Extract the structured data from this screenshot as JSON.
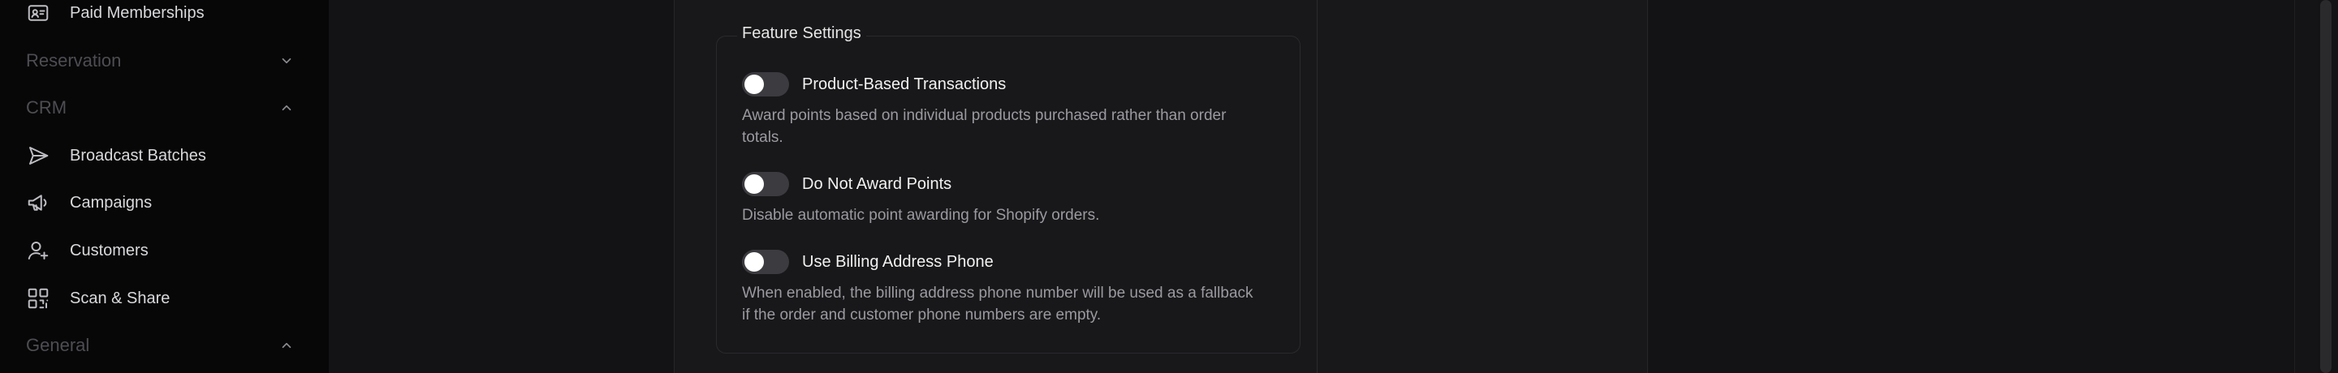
{
  "sidebar": {
    "paid_memberships": "Paid Memberships",
    "sections": {
      "reservation": "Reservation",
      "crm": "CRM",
      "general": "General"
    },
    "crm_items": {
      "broadcast_batches": "Broadcast Batches",
      "campaigns": "Campaigns",
      "customers": "Customers",
      "scan_share": "Scan & Share"
    }
  },
  "feature_settings": {
    "legend": "Feature Settings",
    "settings": [
      {
        "title": "Product-Based Transactions",
        "description": "Award points based on individual products purchased rather than order totals.",
        "enabled": false
      },
      {
        "title": "Do Not Award Points",
        "description": "Disable automatic point awarding for Shopify orders.",
        "enabled": false
      },
      {
        "title": "Use Billing Address Phone",
        "description": "When enabled, the billing address phone number will be used as a fallback if the order and customer phone numbers are empty.",
        "enabled": false
      }
    ]
  },
  "colors": {
    "sidebar_bg": "#070708",
    "panel_bg": "#18181a",
    "toggle_off": "#3b3b40",
    "muted_text": "#9a9aa0"
  }
}
